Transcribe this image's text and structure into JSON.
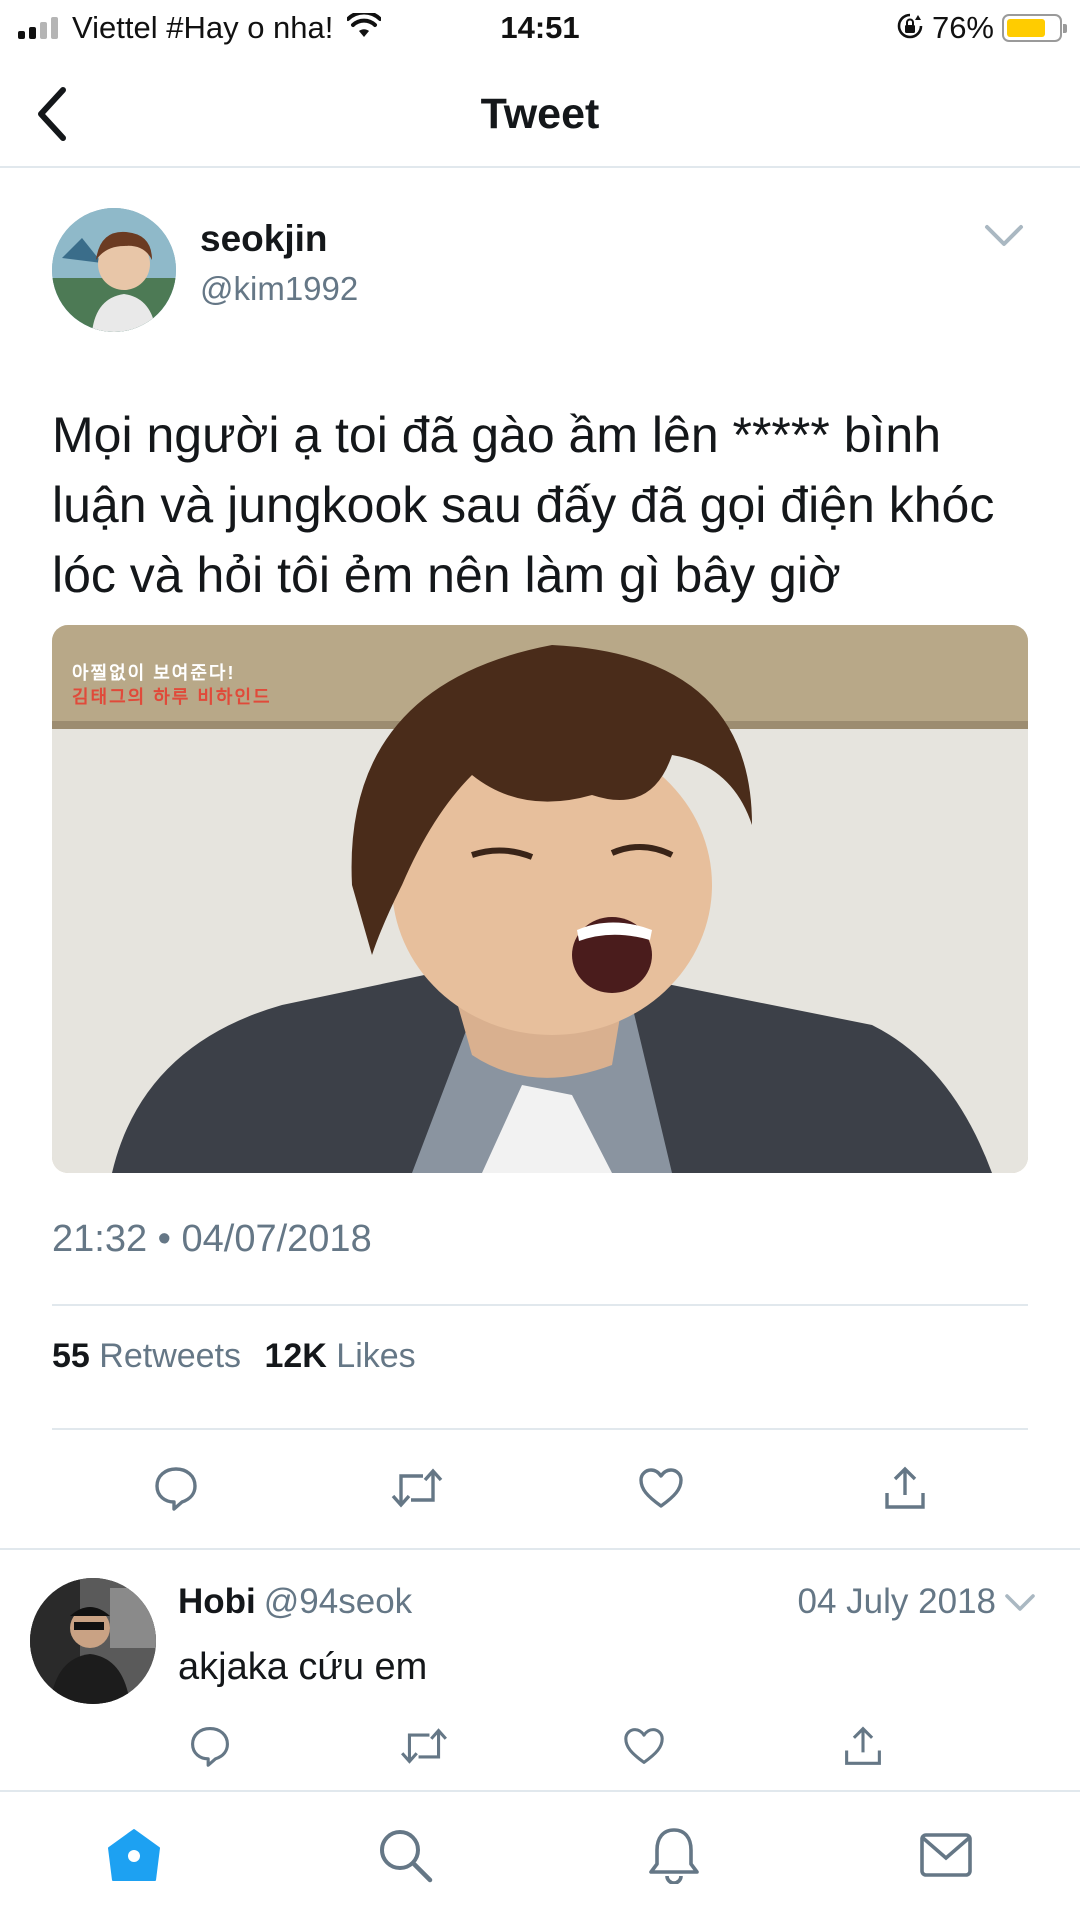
{
  "status_bar": {
    "carrier": "Viettel #Hay o nha!",
    "time": "14:51",
    "battery_percent": "76%",
    "battery_level": 0.76,
    "icons": [
      "signal-icon",
      "wifi-icon",
      "orientation-lock-icon",
      "battery-icon"
    ]
  },
  "header": {
    "title": "Tweet",
    "back_icon": "chevron-left-icon"
  },
  "tweet": {
    "author_name": "seokjin",
    "author_handle": "@kim1992",
    "text": "Mọi người ạ toi đã gào ầm lên ***** bình luận và jungkook sau đấy đã gọi điện khóc lóc và hỏi tôi ẻm nên làm gì bây giờ",
    "image_caption_line1": "아찔없이 보여준다!",
    "image_caption_line2": "김태그의 하루 비하인드",
    "timestamp": "21:32 • 04/07/2018",
    "retweets_count": "55",
    "retweets_label": "Retweets",
    "likes_count": "12K",
    "likes_label": "Likes",
    "actions": [
      "reply-icon",
      "retweet-icon",
      "like-icon",
      "share-icon"
    ]
  },
  "reply": {
    "author_name": "Hobi",
    "author_handle": "@94seok",
    "date": "04 July 2018",
    "text": "akjaka cứu em",
    "actions": [
      "reply-icon",
      "retweet-icon",
      "like-icon",
      "share-icon"
    ]
  },
  "tab_bar": {
    "active": "home",
    "items": [
      "home-icon",
      "search-icon",
      "notifications-icon",
      "messages-icon"
    ],
    "accent_color": "#1da1f2"
  },
  "colors": {
    "text": "#14171a",
    "secondary": "#657786",
    "divider": "#e1e8ed",
    "accent": "#1da1f2",
    "battery": "#ffcc00"
  }
}
